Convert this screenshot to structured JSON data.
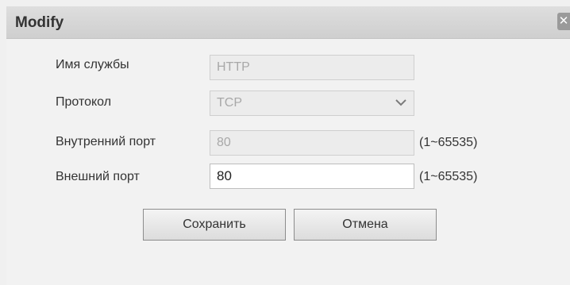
{
  "dialog": {
    "title": "Modify",
    "close_icon": "close-icon"
  },
  "form": {
    "service_name": {
      "label": "Имя службы",
      "value": "HTTP"
    },
    "protocol": {
      "label": "Протокол",
      "value": "TCP",
      "icon": "chevron-down-icon"
    },
    "internal_port": {
      "label": "Внутренний порт",
      "value": "80",
      "range": "(1~65535)"
    },
    "external_port": {
      "label": "Внешний порт",
      "value": "80",
      "range": "(1~65535)"
    }
  },
  "buttons": {
    "save_label": "Сохранить",
    "cancel_label": "Отмена"
  }
}
